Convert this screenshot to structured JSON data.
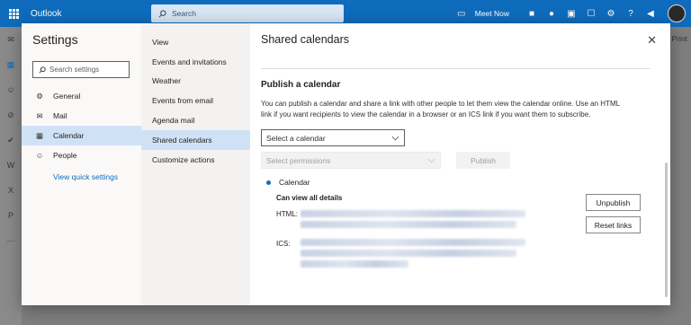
{
  "app": {
    "brand": "Outlook",
    "search_placeholder": "Search",
    "meet_now": "Meet Now",
    "bg_print": "Print"
  },
  "settings": {
    "title": "Settings",
    "search_placeholder": "Search settings",
    "nav": [
      {
        "label": "General",
        "icon": "gear-icon"
      },
      {
        "label": "Mail",
        "icon": "mail-icon"
      },
      {
        "label": "Calendar",
        "icon": "calendar-icon",
        "active": true
      },
      {
        "label": "People",
        "icon": "people-icon"
      }
    ],
    "quick_settings": "View quick settings"
  },
  "subnav": {
    "items": [
      "View",
      "Events and invitations",
      "Weather",
      "Events from email",
      "Agenda mail",
      "Shared calendars",
      "Customize actions"
    ],
    "active_index": 5
  },
  "panel": {
    "title": "Shared calendars",
    "publish_title": "Publish a calendar",
    "description": "You can publish a calendar and share a link with other people to let them view the calendar online. Use an HTML link if you want recipients to view the calendar in a browser or an ICS link if you want them to subscribe.",
    "select_calendar": "Select a calendar",
    "select_permissions": "Select permissions",
    "publish_button": "Publish",
    "calendar_name": "Calendar",
    "permission_label": "Can view all details",
    "html_label": "HTML:",
    "ics_label": "ICS:",
    "unpublish_button": "Unpublish",
    "reset_button": "Reset links"
  }
}
